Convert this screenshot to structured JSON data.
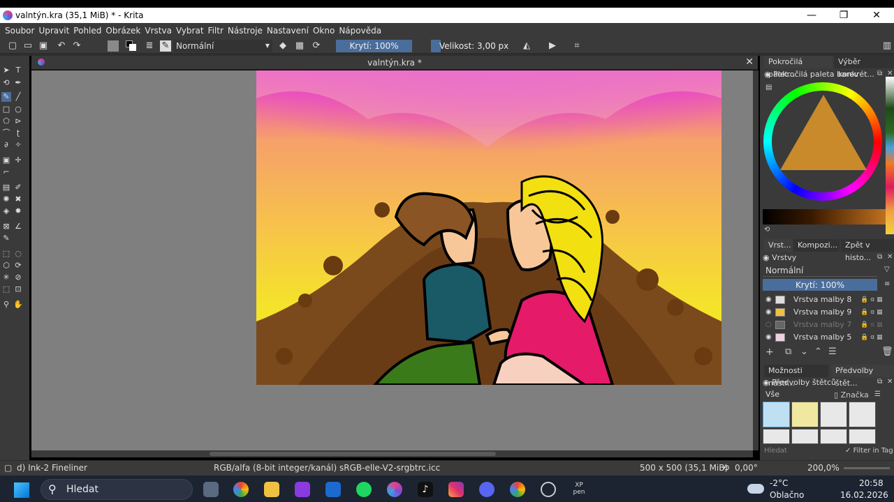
{
  "window": {
    "title": "valntýn.kra (35,1 MiB)  * - Krita",
    "minimize": "—",
    "maximize": "❐",
    "close": "✕"
  },
  "menu": [
    "Soubor",
    "Upravit",
    "Pohled",
    "Obrázek",
    "Vrstva",
    "Vybrat",
    "Filtr",
    "Nástroje",
    "Nastavení",
    "Okno",
    "Nápověda"
  ],
  "toolbar": {
    "blend_mode": "Normální",
    "opacity": "Krytí: 100%",
    "size": "Velikost: 3,00 px"
  },
  "document": {
    "tab_title": "valntýn.kra *"
  },
  "dock": {
    "top_tabs": [
      "Pokročilá palet...",
      "Výběr konkrét..."
    ],
    "palette_title": "Pokročilá paleta barev",
    "mid_tabs": [
      "Vrst...",
      "Kompozi...",
      "Zpět v histo..."
    ],
    "layers_title": "Vrstvy",
    "layers_blend": "Normální",
    "layers_opacity": "Krytí:  100%",
    "layers": [
      {
        "name": "Vrstva malby 8",
        "visible": true
      },
      {
        "name": "Vrstva malby 9",
        "visible": true
      },
      {
        "name": "Vrstva malby 7",
        "visible": false
      },
      {
        "name": "Vrstva malby 5",
        "visible": true
      }
    ],
    "bottom_tabs": [
      "Možnosti nástr...",
      "Předvolby štět..."
    ],
    "brush_title": "Předvolby štětců",
    "brush_filter": "Vše",
    "brush_tag": "Značka",
    "brush_search_placeholder": "Hledat",
    "brush_filter_in_tag": "Filter in Tag"
  },
  "status": {
    "brush": "d) Ink-2 Fineliner",
    "color_model": "RGB/alfa (8-bit integer/kanál)  sRGB-elle-V2-srgbtrc.icc",
    "dimensions": "500 x 500 (35,1 MiB)",
    "rotation": "0,00°",
    "zoom": "200,0%"
  },
  "taskbar": {
    "search": "Hledat",
    "weather_temp": "-2°C",
    "weather_desc": "Oblačno",
    "time": "20:58",
    "date": "16.02.2026"
  },
  "colors": {
    "accent": "#4a6e9c",
    "bg": "#3a3a3a"
  }
}
